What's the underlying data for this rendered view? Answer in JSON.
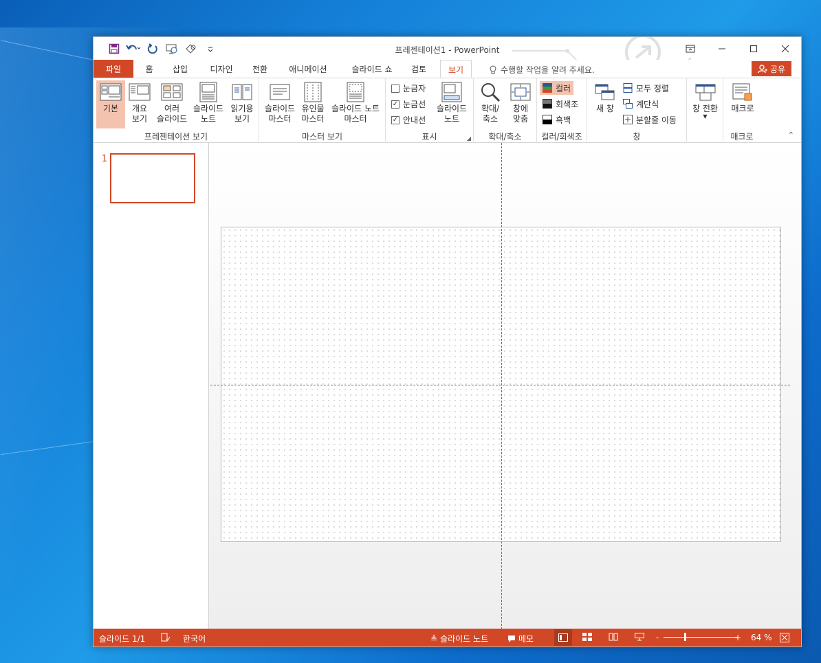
{
  "window": {
    "title": "프레젠테이션1 - PowerPoint"
  },
  "tabs": [
    {
      "label": "파일",
      "id": "file"
    },
    {
      "label": "홈",
      "id": "home"
    },
    {
      "label": "삽입",
      "id": "insert"
    },
    {
      "label": "디자인",
      "id": "design"
    },
    {
      "label": "전환",
      "id": "transitions"
    },
    {
      "label": "애니메이션",
      "id": "animations"
    },
    {
      "label": "슬라이드 쇼",
      "id": "slideshow"
    },
    {
      "label": "검토",
      "id": "review"
    },
    {
      "label": "보기",
      "id": "view"
    }
  ],
  "tell_me": "수행할 작업을 알려 주세요.",
  "share": "공유",
  "ribbon": {
    "presentation_views": {
      "label": "프레젠테이션 보기",
      "normal": "기본",
      "outline": "개요\n보기",
      "sorter": "여러\n슬라이드",
      "notes": "슬라이드\n노트",
      "reading": "읽기용\n보기"
    },
    "master_views": {
      "label": "마스터 보기",
      "slide_master": "슬라이드\n마스터",
      "handout_master": "유인물\n마스터",
      "notes_master": "슬라이드 노트\n마스터"
    },
    "show": {
      "label": "표시",
      "ruler": "눈금자",
      "gridlines": "눈금선",
      "guides": "안내선",
      "notes": "슬라이드\n노트",
      "ruler_checked": false,
      "gridlines_checked": true,
      "guides_checked": true
    },
    "zoom": {
      "label": "확대/축소",
      "zoom": "확대/\n축소",
      "fit": "창에\n맞춤"
    },
    "color": {
      "label": "컬러/회색조",
      "color": "컬러",
      "grayscale": "회색조",
      "bw": "흑백"
    },
    "window": {
      "label": "창",
      "new_window": "새 창",
      "arrange_all": "모두 정렬",
      "cascade": "계단식",
      "move_split": "분할줄 이동"
    },
    "switch": {
      "label": "창 전환"
    },
    "macros": {
      "label": "매크로",
      "macros": "매크로"
    }
  },
  "thumbs": [
    {
      "number": "1"
    }
  ],
  "status": {
    "slide": "슬라이드 1/1",
    "language": "한국어",
    "notes": "슬라이드 노트",
    "comments": "메모",
    "zoom_minus": "-",
    "zoom_plus": "+",
    "zoom": "64 %"
  },
  "colors": {
    "accent": "#d24726",
    "selected": "#f4c3b0"
  }
}
